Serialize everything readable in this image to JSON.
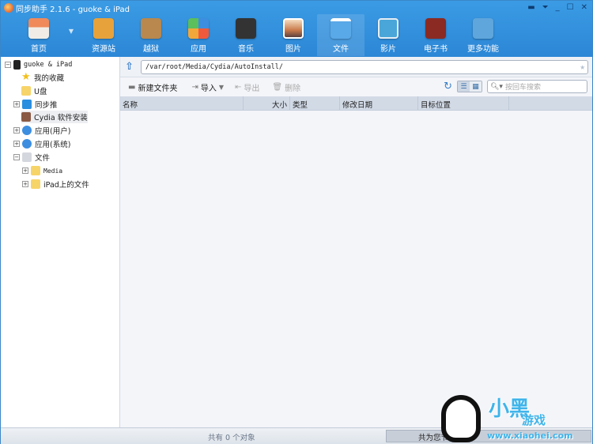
{
  "title": "同步助手 2.1.6 - guoke & iPad",
  "window_controls": [
    "feedback",
    "menu",
    "minimize",
    "maximize",
    "close"
  ],
  "nav": [
    {
      "label": "首页",
      "color": "#e9e3da"
    },
    {
      "label": "资源站",
      "color": "#e7a23c"
    },
    {
      "label": "越狱",
      "color": "#b8884f"
    },
    {
      "label": "应用",
      "color": "#5bbf5b"
    },
    {
      "label": "音乐",
      "color": "#333333"
    },
    {
      "label": "图片",
      "color": "#c97a4a"
    },
    {
      "label": "文件",
      "color": "#59a8e8"
    },
    {
      "label": "影片",
      "color": "#4aa6d8"
    },
    {
      "label": "电子书",
      "color": "#8a2a22"
    },
    {
      "label": "更多功能",
      "color": "#5fa6dc"
    }
  ],
  "sidebar": {
    "device": "guoke & iPad",
    "items": [
      "我的收藏",
      "U盘",
      "同步推",
      "Cydia 软件安装",
      "应用(用户)",
      "应用(系统)",
      "文件",
      "Media",
      "iPad上的文件"
    ]
  },
  "address": "/var/root/Media/Cydia/AutoInstall/",
  "toolbar": {
    "new_folder": "新建文件夹",
    "import": "导入",
    "export": "导出",
    "delete": "删除",
    "search_placeholder": "按回车搜索"
  },
  "columns": [
    "名称",
    "大小",
    "类型",
    "修改日期",
    "目标位置"
  ],
  "status": {
    "count": "共有 0 个对象",
    "saved": "共为您节"
  },
  "watermark": {
    "brand": "小黑",
    "sub": "游戏",
    "url": "www.xiaohei.com"
  }
}
